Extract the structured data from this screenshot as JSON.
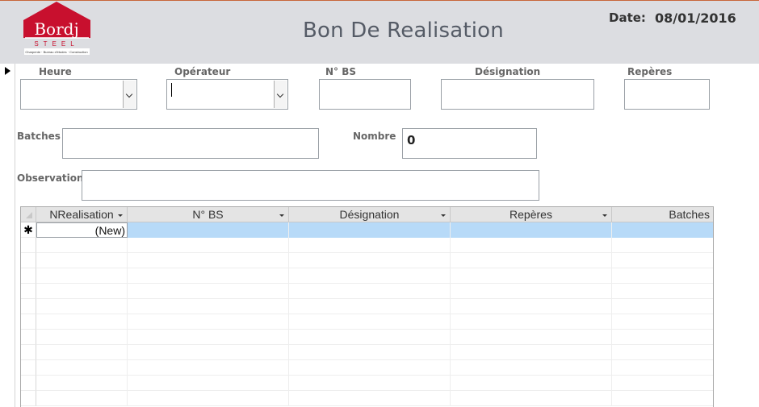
{
  "header": {
    "logo": {
      "name": "Bordj",
      "sub": "STEEL",
      "tagline": "Charpente · Bureau d'études · Construction"
    },
    "title": "Bon De Realisation",
    "date_label": "Date:",
    "date_value": "08/01/2016",
    "colors": {
      "band": "#dcdde1",
      "logo_red": "#c8102e",
      "top_rule": "#c8663a"
    }
  },
  "form": {
    "heure": {
      "label": "Heure",
      "value": ""
    },
    "operateur": {
      "label": "Opérateur",
      "value": ""
    },
    "nbs": {
      "label": "N° BS",
      "value": ""
    },
    "designation": {
      "label": "Désignation",
      "value": ""
    },
    "reperes": {
      "label": "Repères",
      "value": ""
    },
    "batches": {
      "label": "Batches",
      "value": ""
    },
    "nombre": {
      "label": "Nombre",
      "value": "0"
    },
    "observation": {
      "label": "Observation",
      "value": ""
    }
  },
  "grid": {
    "columns": [
      {
        "label": "NRealisation",
        "sortable": true
      },
      {
        "label": "N° BS",
        "sortable": true
      },
      {
        "label": "Désignation",
        "sortable": true
      },
      {
        "label": "Repères",
        "sortable": true
      },
      {
        "label": "Batches",
        "sortable": false
      }
    ],
    "new_row": {
      "marker": "✱",
      "nrealisation": "(New)"
    },
    "selection_color": "#b7daf8"
  }
}
